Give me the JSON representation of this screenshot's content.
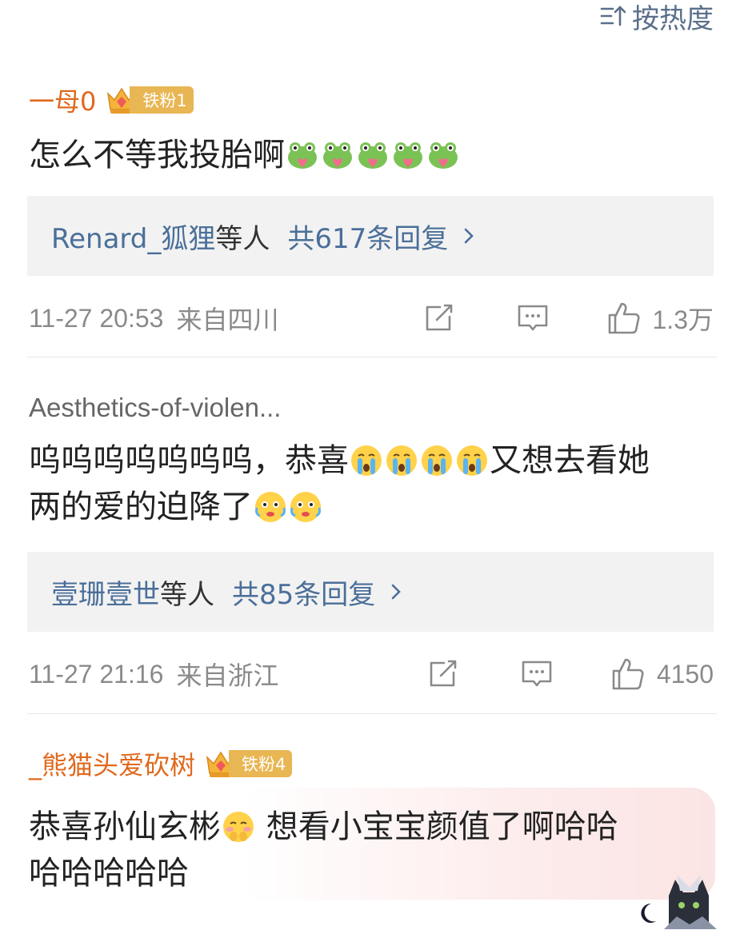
{
  "sort": {
    "label": "按热度"
  },
  "comments": [
    {
      "author": "一母0",
      "fan_badge": "铁粉1",
      "text": "怎么不等我投胎啊",
      "emoji_count": 5,
      "reply": {
        "names": "Renard_狐狸",
        "etc": "等人",
        "count": "共617条回复"
      },
      "time": "11-27 20:53",
      "location": "来自四川",
      "likes": "1.3万"
    },
    {
      "author": "Aesthetics-of-violen...",
      "text_a": "呜呜呜呜呜呜呜，恭喜",
      "text_b": "又想去看她",
      "text_c": "两的爱的迫降了",
      "reply": {
        "names": "壹珊壹世",
        "etc": "等人",
        "count": "共85条回复"
      },
      "time": "11-27 21:16",
      "location": "来自浙江",
      "likes": "4150"
    },
    {
      "author": "_熊猫头爱砍树",
      "fan_badge": "铁粉4",
      "text_a": "恭喜孙仙玄彬",
      "text_b": " 想看小宝宝颜值了啊哈哈",
      "text_c": "哈哈哈哈哈"
    }
  ],
  "colors": {
    "author": "#e0691d",
    "link": "#4a6f99",
    "meta": "#8a8a8a",
    "badge": "#e9b654"
  }
}
